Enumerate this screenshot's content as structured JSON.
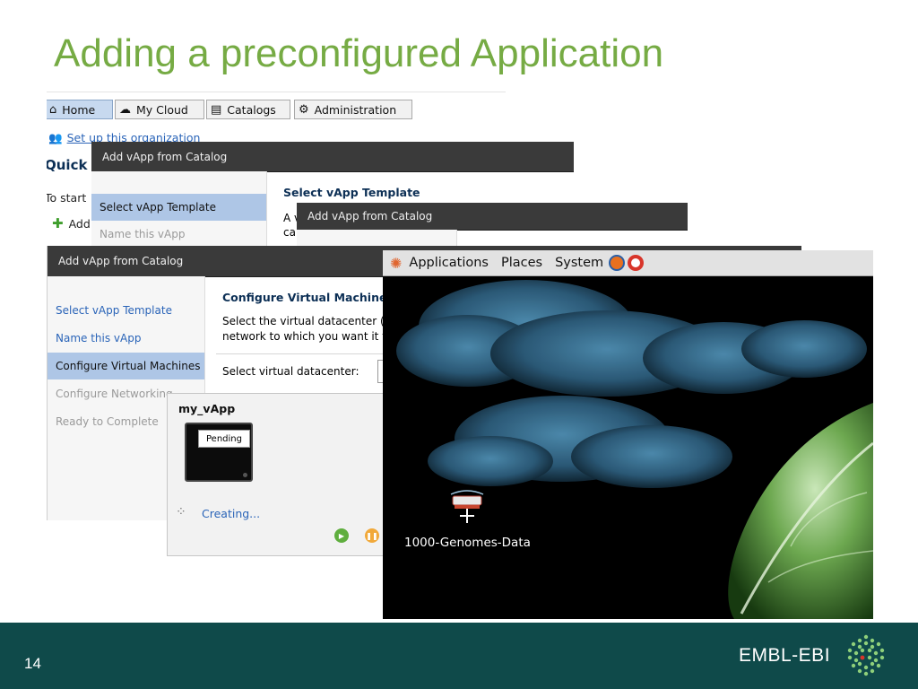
{
  "slide": {
    "title": "Adding a preconfigured Application",
    "page_number": "14",
    "brand": "EMBL-EBI"
  },
  "portal": {
    "tabs": [
      {
        "label": "Home",
        "icon": "home-icon",
        "active": true
      },
      {
        "label": "My Cloud",
        "icon": "cloud-icon",
        "active": false
      },
      {
        "label": "Catalogs",
        "icon": "catalog-icon",
        "active": false
      },
      {
        "label": "Administration",
        "icon": "admin-icon",
        "active": false
      }
    ],
    "setup_link": "Set up this organization",
    "quick_heading": "Quick",
    "to_start": "To start",
    "add_item": "Add"
  },
  "dialog_back": {
    "title": "Add vApp from Catalog",
    "steps": [
      "Select vApp Template",
      "Name this vApp"
    ],
    "heading": "Select vApp Template",
    "body_line1": "A v",
    "body_line2": "ca"
  },
  "dialog_mid": {
    "title": "Add vApp from Catalog"
  },
  "dialog_front": {
    "title": "Add vApp from Catalog",
    "steps": [
      "Select vApp Template",
      "Name this vApp",
      "Configure Virtual Machines",
      "Configure Networking",
      "Ready to Complete"
    ],
    "heading": "Configure Virtual Machine",
    "desc_line1": "Select the virtual datacenter (",
    "desc_line2": "network to which you want it t",
    "datacenter_label": "Select virtual datacenter:"
  },
  "vapp": {
    "name": "my_vApp",
    "status": "Pending",
    "progress": "Creating..."
  },
  "desktop": {
    "menus": [
      "Applications",
      "Places",
      "System"
    ],
    "icon_label": "1000-Genomes-Data"
  },
  "colors": {
    "title_green": "#76ab44",
    "footer_teal": "#0f4a4a",
    "link_blue": "#2a64b8",
    "selected_step": "#aec6e6"
  }
}
